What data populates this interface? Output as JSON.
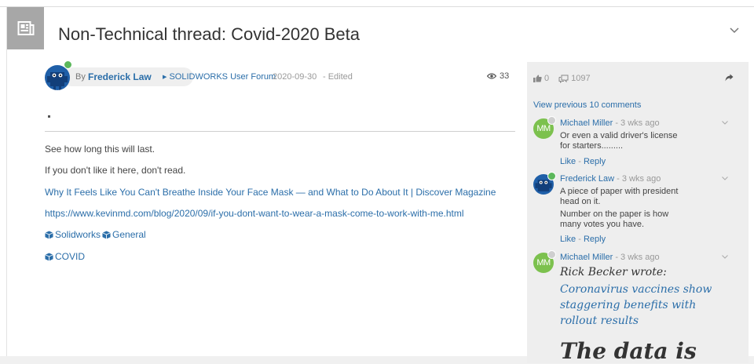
{
  "post": {
    "title": "Non-Technical thread: Covid-2020 Beta",
    "by_label": "By",
    "author": "Frederick Law",
    "forum": "SOLIDWORKS User Forum",
    "date": "2020-09-30",
    "edited": "- Edited",
    "views": "33",
    "dot_text": ".",
    "lines": [
      "See how long this will last.",
      "If you don't like it here, don't read."
    ],
    "links": [
      "Why It Feels Like You Can't Breathe Inside Your Face Mask — and What to Do About It | Discover Magazine",
      "https://www.kevinmd.com/blog/2020/09/if-you-dont-want-to-wear-a-mask-come-to-work-with-me.html"
    ],
    "tags_row1": [
      "Solidworks",
      "General"
    ],
    "tags_row2": [
      "COVID"
    ]
  },
  "sidebar": {
    "likes": "0",
    "replies": "1097",
    "view_previous": "View previous 10 comments",
    "comments": [
      {
        "initials": "MM",
        "name": "Michael Miller",
        "time": "- 3 wks ago",
        "text": "Or even a valid driver's license for starters.........",
        "like": "Like",
        "separator": "-",
        "reply": "Reply"
      },
      {
        "name": "Frederick Law",
        "time": "- 3 wks ago",
        "text1": "A piece of paper with president head on it.",
        "text2": "Number on the paper is how many votes you have.",
        "like": "Like",
        "separator": "-",
        "reply": "Reply"
      },
      {
        "initials": "MM",
        "name": "Michael Miller",
        "time": "- 3 wks ago",
        "quote_author": "Rick Becker wrote:",
        "quote_link": "Coronavirus vaccines show staggering benefits with rollout results",
        "big_text": "The data is"
      }
    ]
  },
  "colors": {
    "link": "#2b6ea9",
    "online": "#5cb85c",
    "mm_avatar": "#7cc14e",
    "sidebar_bg": "#eeeeee"
  },
  "icons": [
    "newspaper-icon",
    "chevron-down-icon",
    "eye-icon",
    "thumbs-up-icon",
    "comments-icon",
    "share-icon",
    "cube-icon",
    "caret-right-icon"
  ]
}
